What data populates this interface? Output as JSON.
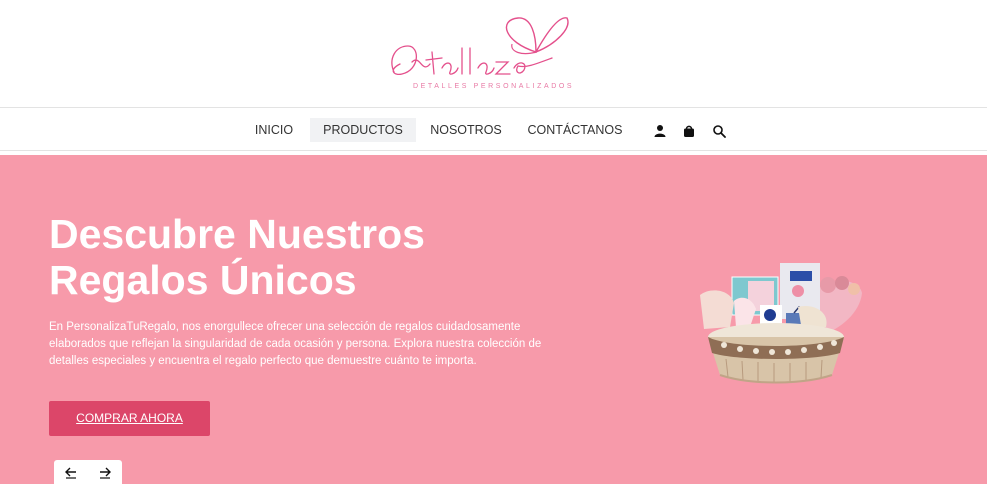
{
  "brand": {
    "script_name": "Detallazo",
    "tagline": "DETALLES PERSONALIZADOS",
    "color": "#e4508c"
  },
  "nav": {
    "items": [
      {
        "label": "INICIO"
      },
      {
        "label": "PRODUCTOS",
        "active": true
      },
      {
        "label": "NOSOTROS"
      },
      {
        "label": "CONTÁCTANOS"
      }
    ],
    "icons": [
      "user-icon",
      "shopping-bag-icon",
      "search-icon"
    ]
  },
  "hero": {
    "background": "#f79aaa",
    "title_line1": "Descubre Nuestros",
    "title_line2": "Regalos Únicos",
    "description": "En PersonalizaTuRegalo, nos enorgullece ofrecer una selección de regalos cuidadosamente elaborados que reflejan la singularidad de cada ocasión y persona. Explora nuestra colección de detalles especiales y encuentra el regalo perfecto que demuestre cuánto te importa.",
    "cta_label": "COMPRAR AHORA",
    "cta_color": "#dc4669",
    "prev_icon": "arrow-left-icon",
    "next_icon": "arrow-right-icon",
    "product_image": "gift-basket-image"
  }
}
